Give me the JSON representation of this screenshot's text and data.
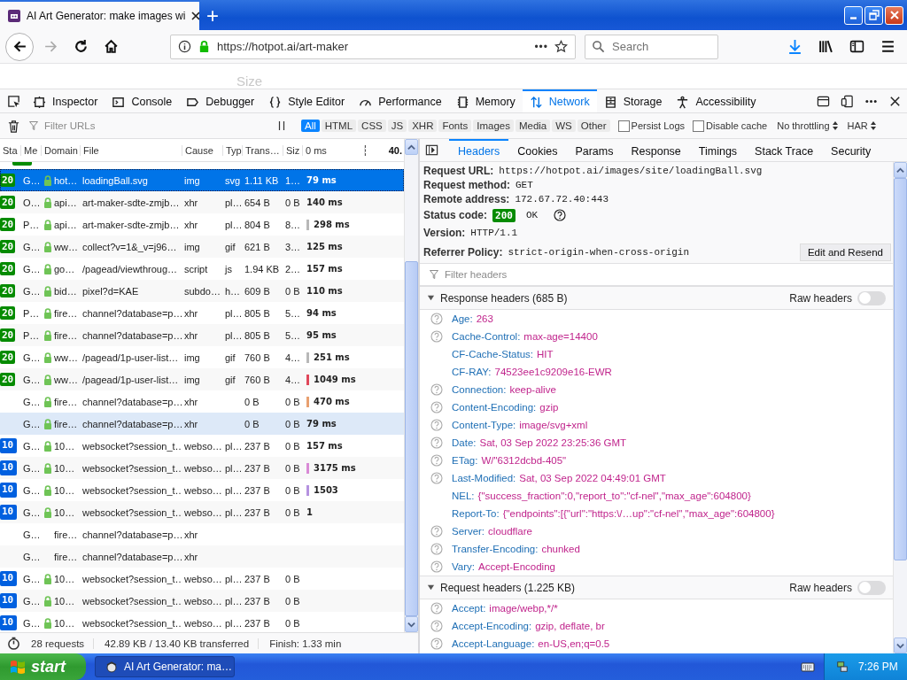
{
  "browser": {
    "tab": {
      "title": "AI Art Generator: make images wi",
      "selected": true
    },
    "new_tab": "+",
    "url": "https://hotpot.ai/art-maker",
    "page_actions": "•••",
    "search": {
      "placeholder": "Search"
    }
  },
  "page": {
    "label": "Size"
  },
  "devtools": {
    "tabs": [
      {
        "label": "Inspector",
        "selected": false
      },
      {
        "label": "Console",
        "selected": false
      },
      {
        "label": "Debugger",
        "selected": false
      },
      {
        "label": "Style Editor",
        "selected": false
      },
      {
        "label": "Performance",
        "selected": false
      },
      {
        "label": "Memory",
        "selected": false
      },
      {
        "label": "Network",
        "selected": true
      },
      {
        "label": "Storage",
        "selected": false
      },
      {
        "label": "Accessibility",
        "selected": false
      }
    ]
  },
  "toolbar": {
    "filter": {
      "placeholder": "Filter URLs"
    },
    "types": [
      {
        "label": "All",
        "selected": true
      },
      {
        "label": "HTML",
        "selected": false
      },
      {
        "label": "CSS",
        "selected": false
      },
      {
        "label": "JS",
        "selected": false
      },
      {
        "label": "XHR",
        "selected": false
      },
      {
        "label": "Fonts",
        "selected": false
      },
      {
        "label": "Images",
        "selected": false
      },
      {
        "label": "Media",
        "selected": false
      },
      {
        "label": "WS",
        "selected": false
      },
      {
        "label": "Other",
        "selected": false
      }
    ],
    "options": [
      {
        "label": "Persist Logs",
        "checked": false
      },
      {
        "label": "Disable cache",
        "checked": false
      }
    ],
    "throttling": "No throttling",
    "har": "HAR"
  },
  "requests": {
    "columns": [
      "Sta",
      "Me",
      "Domain",
      "File",
      "Cause",
      "Typ",
      "Trans…",
      "Siz",
      "0 ms"
    ],
    "timeline_end": "40.",
    "rows": [
      {
        "status": "20",
        "kind": "ok",
        "method": "G…",
        "secure": true,
        "domain": "hot…",
        "file": "loadingBall.svg",
        "cause": "img",
        "type": "svg",
        "transferred": "1.11 KB",
        "size": "1…",
        "waterfall": {
          "label": "79 ms"
        },
        "selected": true,
        "hovered": false
      },
      {
        "status": "20",
        "kind": "ok",
        "method": "O…",
        "secure": true,
        "domain": "api…",
        "file": "art-maker-sdte-zmjb…",
        "cause": "xhr",
        "type": "pl…",
        "transferred": "654 B",
        "size": "0 B",
        "waterfall": {
          "label": "140 ms"
        },
        "selected": false,
        "hovered": false
      },
      {
        "status": "20",
        "kind": "ok",
        "method": "P…",
        "secure": true,
        "domain": "api…",
        "file": "art-maker-sdte-zmjb…",
        "cause": "xhr",
        "type": "pl…",
        "transferred": "804 B",
        "size": "8…",
        "waterfall": {
          "label": "298 ms",
          "color": "#b8b8b8"
        },
        "selected": false,
        "hovered": false
      },
      {
        "status": "20",
        "kind": "ok",
        "method": "G…",
        "secure": true,
        "domain": "ww…",
        "file": "collect?v=1&_v=j96…",
        "cause": "img",
        "type": "gif",
        "transferred": "621 B",
        "size": "3…",
        "waterfall": {
          "label": "125 ms"
        },
        "selected": false,
        "hovered": false
      },
      {
        "status": "20",
        "kind": "ok",
        "method": "G…",
        "secure": true,
        "domain": "go…",
        "file": "/pagead/viewthroug…",
        "cause": "script",
        "type": "js",
        "transferred": "1.94 KB",
        "size": "2…",
        "waterfall": {
          "label": "157 ms"
        },
        "selected": false,
        "hovered": false
      },
      {
        "status": "20",
        "kind": "ok",
        "method": "G…",
        "secure": true,
        "domain": "bid…",
        "file": "pixel?d=KAE",
        "cause": "subdo…",
        "type": "h…",
        "transferred": "609 B",
        "size": "0 B",
        "waterfall": {
          "label": "110 ms"
        },
        "selected": false,
        "hovered": false
      },
      {
        "status": "20",
        "kind": "ok",
        "method": "P…",
        "secure": true,
        "domain": "fire…",
        "file": "channel?database=p…",
        "cause": "xhr",
        "type": "pl…",
        "transferred": "805 B",
        "size": "5…",
        "waterfall": {
          "label": "94 ms"
        },
        "selected": false,
        "hovered": false
      },
      {
        "status": "20",
        "kind": "ok",
        "method": "P…",
        "secure": true,
        "domain": "fire…",
        "file": "channel?database=p…",
        "cause": "xhr",
        "type": "pl…",
        "transferred": "805 B",
        "size": "5…",
        "waterfall": {
          "label": "95 ms"
        },
        "selected": false,
        "hovered": false
      },
      {
        "status": "20",
        "kind": "ok",
        "method": "G…",
        "secure": true,
        "domain": "ww…",
        "file": "/pagead/1p-user-list…",
        "cause": "img",
        "type": "gif",
        "transferred": "760 B",
        "size": "4…",
        "waterfall": {
          "label": "251 ms",
          "color": "#b8b8b8"
        },
        "selected": false,
        "hovered": false
      },
      {
        "status": "20",
        "kind": "ok",
        "method": "G…",
        "secure": true,
        "domain": "ww…",
        "file": "/pagead/1p-user-list…",
        "cause": "img",
        "type": "gif",
        "transferred": "760 B",
        "size": "4…",
        "waterfall": {
          "label": "1049 ms",
          "color": "#e0475a"
        },
        "selected": false,
        "hovered": false
      },
      {
        "method": "G…",
        "secure": true,
        "domain": "fire…",
        "file": "channel?database=p…",
        "cause": "xhr",
        "transferred": "0 B",
        "size": "0 B",
        "waterfall": {
          "label": "470 ms",
          "color": "#e8a070"
        },
        "selected": false,
        "hovered": false
      },
      {
        "method": "G…",
        "secure": true,
        "domain": "fire…",
        "file": "channel?database=p…",
        "cause": "xhr",
        "transferred": "0 B",
        "size": "0 B",
        "waterfall": {
          "label": "79 ms"
        },
        "selected": false,
        "hovered": true
      },
      {
        "status": "10",
        "kind": "switch",
        "method": "G…",
        "secure": true,
        "domain": "10…",
        "file": "websocket?session_t…",
        "cause": "webso…",
        "type": "pl…",
        "transferred": "237 B",
        "size": "0 B",
        "waterfall": {
          "label": "157 ms"
        },
        "selected": false,
        "hovered": false
      },
      {
        "status": "10",
        "kind": "switch",
        "method": "G…",
        "secure": true,
        "domain": "10…",
        "file": "websocket?session_t…",
        "cause": "webso…",
        "type": "pl…",
        "transferred": "237 B",
        "size": "0 B",
        "waterfall": {
          "label": "3175 ms",
          "color": "#d98ad6"
        },
        "selected": false,
        "hovered": false
      },
      {
        "status": "10",
        "kind": "switch",
        "method": "G…",
        "secure": true,
        "domain": "10…",
        "file": "websocket?session_t…",
        "cause": "webso…",
        "type": "pl…",
        "transferred": "237 B",
        "size": "0 B",
        "waterfall": {
          "label": "1503",
          "color": "#b592e0"
        },
        "selected": false,
        "hovered": false
      },
      {
        "status": "10",
        "kind": "switch",
        "method": "G…",
        "secure": true,
        "domain": "10…",
        "file": "websocket?session_t…",
        "cause": "webso…",
        "type": "pl…",
        "transferred": "237 B",
        "size": "0 B",
        "waterfall": {
          "label": "1"
        },
        "selected": false,
        "hovered": false
      },
      {
        "method": "G…",
        "secure": false,
        "domain": "fire…",
        "file": "channel?database=p…",
        "cause": "xhr",
        "selected": false,
        "hovered": false
      },
      {
        "method": "G…",
        "secure": false,
        "domain": "fire…",
        "file": "channel?database=p…",
        "cause": "xhr",
        "selected": false,
        "hovered": false
      },
      {
        "status": "10",
        "kind": "switch",
        "method": "G…",
        "secure": true,
        "domain": "10…",
        "file": "websocket?session_t…",
        "cause": "webso…",
        "type": "pl…",
        "transferred": "237 B",
        "size": "0 B",
        "selected": false,
        "hovered": false
      },
      {
        "status": "10",
        "kind": "switch",
        "method": "G…",
        "secure": true,
        "domain": "10…",
        "file": "websocket?session_t…",
        "cause": "webso…",
        "type": "pl…",
        "transferred": "237 B",
        "size": "0 B",
        "selected": false,
        "hovered": false
      },
      {
        "status": "10",
        "kind": "switch",
        "method": "G…",
        "secure": true,
        "domain": "10…",
        "file": "websocket?session_t…",
        "cause": "webso…",
        "type": "pl…",
        "transferred": "237 B",
        "size": "0 B",
        "selected": false,
        "hovered": false
      }
    ]
  },
  "status_bar": {
    "requests": "28 requests",
    "transferred": "42.89 KB / 13.40 KB transferred",
    "finish": "Finish: 1.33 min"
  },
  "detail": {
    "tabs": [
      {
        "label": "Headers",
        "selected": true
      },
      {
        "label": "Cookies",
        "selected": false
      },
      {
        "label": "Params",
        "selected": false
      },
      {
        "label": "Response",
        "selected": false
      },
      {
        "label": "Timings",
        "selected": false
      },
      {
        "label": "Stack Trace",
        "selected": false
      },
      {
        "label": "Security",
        "selected": false
      }
    ],
    "summary": [
      {
        "label": "Request URL:",
        "value": "https://hotpot.ai/images/site/loadingBall.svg"
      },
      {
        "label": "Request method:",
        "value": "GET"
      },
      {
        "label": "Remote address:",
        "value": "172.67.72.40:443"
      }
    ],
    "status": {
      "label": "Status code:",
      "code": "200",
      "text": "OK"
    },
    "version": {
      "label": "Version:",
      "value": "HTTP/1.1"
    },
    "referrer": {
      "label": "Referrer Policy:",
      "value": "strict-origin-when-cross-origin"
    },
    "resend_button": "Edit and Resend",
    "filter": {
      "placeholder": "Filter headers"
    },
    "sections": [
      {
        "title": "Response headers (685 B)",
        "expanded": true,
        "raw_label": "Raw headers",
        "raw": false,
        "headers": [
          {
            "name": "Age:",
            "value": "263",
            "help": true
          },
          {
            "name": "Cache-Control:",
            "value": "max-age=14400",
            "help": true
          },
          {
            "name": "CF-Cache-Status:",
            "value": "HIT",
            "help": false
          },
          {
            "name": "CF-RAY:",
            "value": "74523ee1c9209e16-EWR",
            "help": false
          },
          {
            "name": "Connection:",
            "value": "keep-alive",
            "help": true
          },
          {
            "name": "Content-Encoding:",
            "value": "gzip",
            "help": true
          },
          {
            "name": "Content-Type:",
            "value": "image/svg+xml",
            "help": true
          },
          {
            "name": "Date:",
            "value": "Sat, 03 Sep 2022 23:25:36 GMT",
            "help": true
          },
          {
            "name": "ETag:",
            "value": "W/\"6312dcbd-405\"",
            "help": true
          },
          {
            "name": "Last-Modified:",
            "value": "Sat, 03 Sep 2022 04:49:01 GMT",
            "help": true
          },
          {
            "name": "NEL:",
            "value": "{\"success_fraction\":0,\"report_to\":\"cf-nel\",\"max_age\":604800}",
            "help": false
          },
          {
            "name": "Report-To:",
            "value": "{\"endpoints\":[{\"url\":\"https:\\/…up\":\"cf-nel\",\"max_age\":604800}",
            "help": false
          },
          {
            "name": "Server:",
            "value": "cloudflare",
            "help": true
          },
          {
            "name": "Transfer-Encoding:",
            "value": "chunked",
            "help": true
          },
          {
            "name": "Vary:",
            "value": "Accept-Encoding",
            "help": true
          }
        ]
      },
      {
        "title": "Request headers (1.225 KB)",
        "expanded": true,
        "raw_label": "Raw headers",
        "raw": false,
        "headers": [
          {
            "name": "Accept:",
            "value": "image/webp,*/*",
            "help": true
          },
          {
            "name": "Accept-Encoding:",
            "value": "gzip, deflate, br",
            "help": true
          },
          {
            "name": "Accept-Language:",
            "value": "en-US,en;q=0.5",
            "help": true
          }
        ]
      }
    ]
  },
  "taskbar": {
    "start": "start",
    "task": "AI Art Generator: ma…",
    "clock": "7:26 PM"
  }
}
